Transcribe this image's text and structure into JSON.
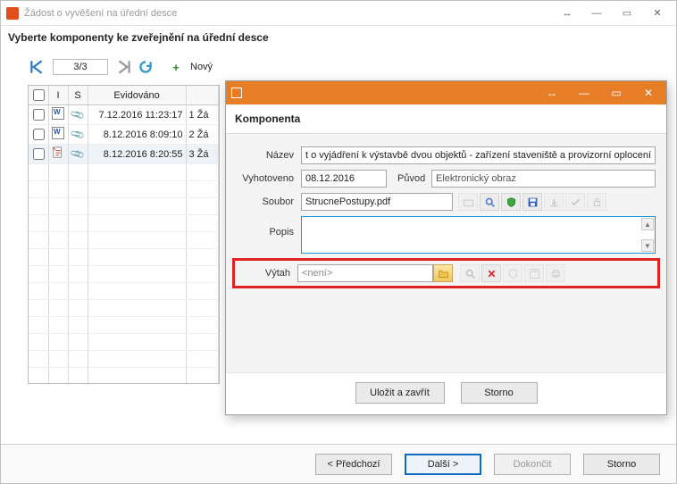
{
  "outer": {
    "title": "Žádost o vyvěšení na úřední desce",
    "subtitle": "Vyberte komponenty ke zveřejnění na úřední desce",
    "pager": "3/3",
    "new_label": "Nový",
    "prev": "<  Předchozí",
    "next": "Další  >",
    "finish": "Dokončit",
    "cancel": "Storno"
  },
  "table": {
    "head": {
      "chk": "",
      "i": "I",
      "s": "S",
      "evidovano": "Evidováno"
    },
    "rows": [
      {
        "date": "7.12.2016 11:23:17",
        "rest": "1 Žá",
        "type": "w",
        "sel": false
      },
      {
        "date": "8.12.2016 8:09:10",
        "rest": "2 Žá",
        "type": "w",
        "sel": false
      },
      {
        "date": "8.12.2016 8:20:55",
        "rest": "3 Žá",
        "type": "pdf",
        "sel": true
      }
    ]
  },
  "modal": {
    "title": "Komponenta",
    "labels": {
      "nazev": "Název",
      "vyhotoveno": "Vyhotoveno",
      "puvod": "Původ",
      "soubor": "Soubor",
      "popis": "Popis",
      "vytah": "Výtah"
    },
    "values": {
      "nazev": "t o vyjádření k výstavbě dvou objektů - zařízení staveniště a provizorní oplocení",
      "vyhotoveno": "08.12.2016",
      "puvod": "Elektronický obraz",
      "soubor": "StrucnePostupy.pdf",
      "popis": "",
      "vytah": "<není>"
    },
    "buttons": {
      "save": "Uložit a zavřít",
      "cancel": "Storno"
    }
  }
}
